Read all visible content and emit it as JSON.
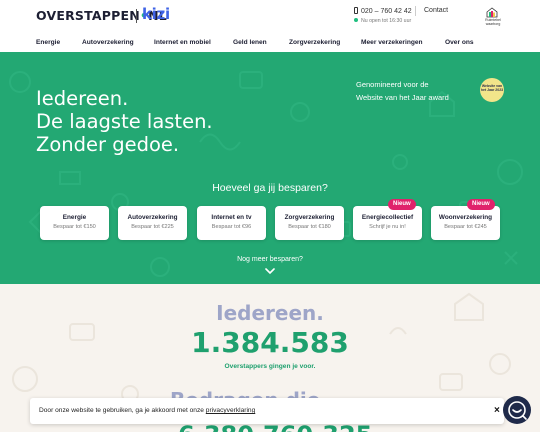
{
  "header": {
    "logo_left": "OVERSTAPPEN",
    "logo_dot": "•",
    "logo_right": "NL",
    "partner_logo": "kizi",
    "phone": "020 – 760 42 42",
    "open_status": "Nu open tot 16:30 uur",
    "contact": "Contact",
    "award_label": "Ruimtebel waarborg"
  },
  "nav": [
    "Energie",
    "Autoverzekering",
    "Internet en mobiel",
    "Geld lenen",
    "Zorgverzekering",
    "Meer verzekeringen",
    "Over ons"
  ],
  "hero": {
    "lines": [
      "Iedereen.",
      "De laagste lasten.",
      "Zonder gedoe."
    ],
    "award_line1": "Genomineerd voor de",
    "award_line2": "Website van het Jaar award",
    "award_seal": "Website van het Jaar 2023",
    "question": "Hoeveel ga jij besparen?",
    "more": "Nog meer besparen?"
  },
  "cards": [
    {
      "title": "Energie",
      "sub": "Bespaar tot €150",
      "badge": ""
    },
    {
      "title": "Autoverzekering",
      "sub": "Bespaar tot €225",
      "badge": ""
    },
    {
      "title": "Internet en tv",
      "sub": "Bespaar tot €96",
      "badge": ""
    },
    {
      "title": "Zorgverzekering",
      "sub": "Bespaar tot €180",
      "badge": ""
    },
    {
      "title": "Energiecollectief",
      "sub": "Schrijf je nu in!",
      "badge": "Nieuw"
    },
    {
      "title": "Woonverzekering",
      "sub": "Bespaar tot €245",
      "badge": "Nieuw"
    }
  ],
  "stats": {
    "head": "Iedereen.",
    "number": "1.384.583",
    "caption": "Overstappers gingen je voor.",
    "next_head": "Bedragen die",
    "next_number": "6.380.760.325"
  },
  "cookie": {
    "text": "Door onze website te gebruiken, ga je akkoord met onze ",
    "link": "privacyverklaring",
    "close": "×"
  },
  "colors": {
    "hero": "#23a873",
    "accent": "#1fa06e",
    "badge": "#e0226b",
    "brand_blue": "#3f63e6"
  }
}
